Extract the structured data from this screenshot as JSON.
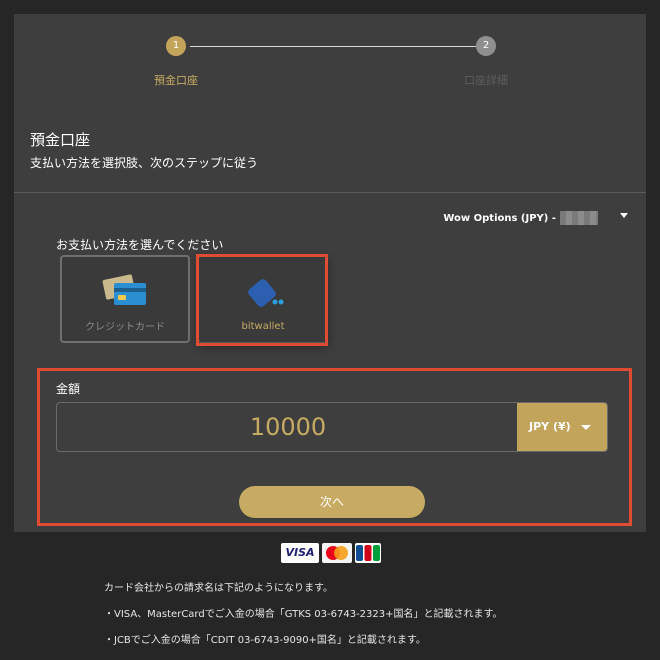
{
  "stepper": {
    "step1_number": "1",
    "step1_label": "預金口座",
    "step2_number": "2",
    "step2_label": "口座詳細"
  },
  "header": {
    "title": "預金口座",
    "subtitle": "支払い方法を選択肢、次のステップに従う"
  },
  "account": {
    "label": "Wow Options (JPY) -",
    "icon": "chevron-down-icon"
  },
  "payment": {
    "title": "お支払い方法を選んでください",
    "methods": [
      {
        "label": "クレジットカード",
        "icon": "credit-card-icon",
        "selected": false
      },
      {
        "label": "bitwallet",
        "icon": "bitwallet-icon",
        "selected": true
      }
    ]
  },
  "amount": {
    "label": "金額",
    "value": "10000",
    "currency": "JPY (¥)"
  },
  "actions": {
    "next_label": "次へ"
  },
  "brands": {
    "visa": "VISA",
    "mastercard": "MasterCard",
    "jcb": "JCB"
  },
  "notes": {
    "line1": "カード会社からの請求名は下記のようになります。",
    "line2": "・VISA、MasterCardでご入金の場合「GTKS 03-6743-2323+国名」と記載されます。",
    "line3": "・JCBでご入金の場合「CDIT 03-6743-9090+国名」と記載されます。"
  },
  "colors": {
    "accent": "#c8ab62",
    "highlight": "#e24b33",
    "panel": "#3e3e3e",
    "background": "#262626"
  }
}
